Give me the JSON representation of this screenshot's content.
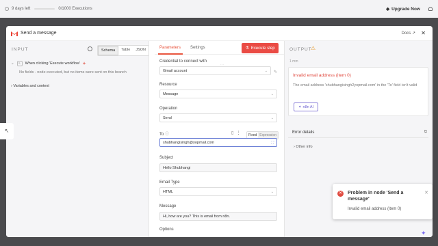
{
  "topbar": {
    "days_left": "9 days left",
    "executions": "0/1000 Executions",
    "upgrade": "Upgrade Now"
  },
  "modal": {
    "title": "Send a message",
    "docs": "Docs"
  },
  "input": {
    "label": "INPUT",
    "tabs": [
      "Schema",
      "Table",
      "JSON"
    ],
    "trigger": "When clicking 'Execute workflow'",
    "no_fields": "No fields - node executed, but no items were sent on this branch",
    "vars": "Variables and context"
  },
  "params": {
    "tab_parameters": "Parameters",
    "tab_settings": "Settings",
    "execute": "Execute step",
    "credential_label": "Credential to connect with",
    "credential_value": "Gmail account",
    "resource_label": "Resource",
    "resource_value": "Message",
    "operation_label": "Operation",
    "operation_value": "Send",
    "to_label": "To",
    "to_value": "shubhangisingh@yopmail.com",
    "fixed": "Fixed",
    "expression": "Expression",
    "subject_label": "Subject",
    "subject_value": "Hello Shubhangi",
    "email_type_label": "Email Type",
    "email_type_value": "HTML",
    "message_label": "Message",
    "message_value": "Hi, how are you? This is email from n8n.",
    "options_label": "Options"
  },
  "output": {
    "label": "OUTPUT",
    "time": "1 mm",
    "error_title": "Invalid email address (item 0)",
    "error_desc": "The email address 'shubhangisingh2yopmail.com' in the 'To' field isn't valid",
    "ask_ai": "n8n AI",
    "error_details": "Error details",
    "other_info": "Other info"
  },
  "toast": {
    "title": "Problem in node 'Send a message'",
    "message": "Invalid email address (item 0)"
  },
  "colors": {
    "accent": "#ea4b44",
    "error": "#e14d43",
    "ai": "#6a5ed0"
  }
}
